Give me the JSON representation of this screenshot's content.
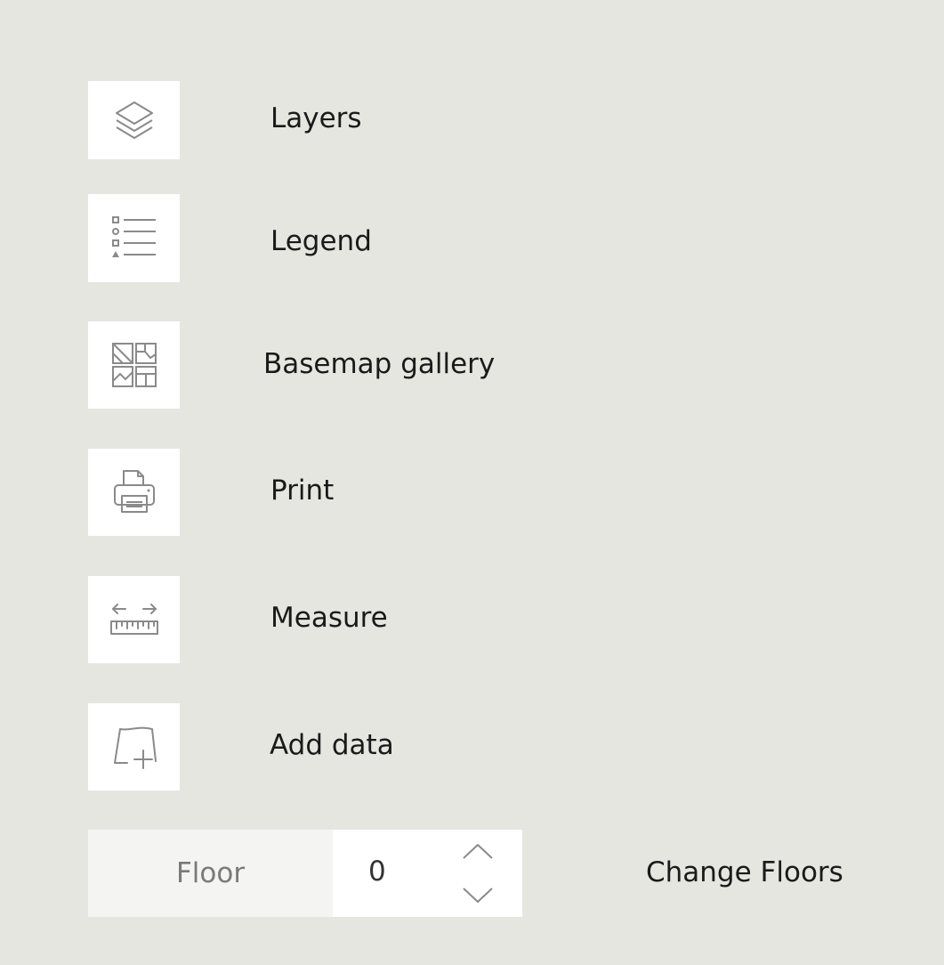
{
  "tools": [
    {
      "name": "layers",
      "label": "Layers",
      "icon": "layers-icon"
    },
    {
      "name": "legend",
      "label": "Legend",
      "icon": "legend-icon"
    },
    {
      "name": "basemap-gallery",
      "label": "Basemap gallery",
      "icon": "basemap-gallery-icon"
    },
    {
      "name": "print",
      "label": "Print",
      "icon": "printer-icon"
    },
    {
      "name": "measure",
      "label": "Measure",
      "icon": "ruler-icon"
    },
    {
      "name": "add-data",
      "label": "Add data",
      "icon": "add-data-icon"
    }
  ],
  "floor": {
    "label": "Floor",
    "value": "0",
    "change_label": "Change Floors"
  },
  "colors": {
    "background": "#e6e6e1",
    "button_bg": "#ffffff",
    "icon_stroke": "#8a8a8a",
    "text": "#1a1a1a"
  }
}
